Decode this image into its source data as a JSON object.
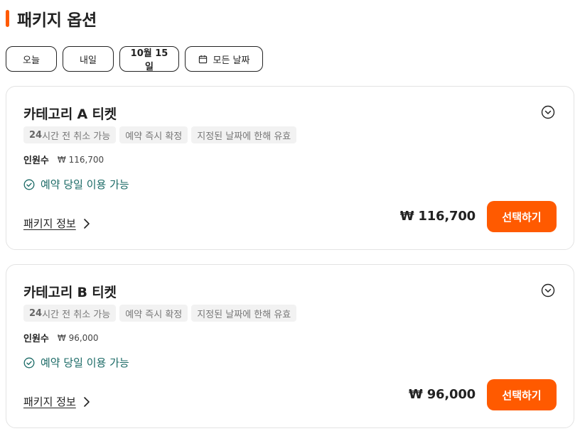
{
  "section": {
    "title": "패키지 옵션",
    "accent_color": "#ff5a00"
  },
  "date_filters": {
    "today": "오늘",
    "tomorrow": "내일",
    "date": "10월 15일",
    "all_dates": "모든 날짜",
    "calendar_icon": "calendar-icon"
  },
  "packages": [
    {
      "title": "카테고리 A 티켓",
      "tags": [
        {
          "num": "24",
          "text": "시간 전 취소 가능"
        },
        {
          "text": "예약 즉시 확정"
        },
        {
          "text": "지정된 날짜에 한해 유효"
        }
      ],
      "people_label": "인원수",
      "people_price": "₩ 116,700",
      "sameday": "예약 당일 이용 가능",
      "info_link": "패키지 정보",
      "price": "₩ 116,700",
      "select_label": "선택하기"
    },
    {
      "title": "카테고리 B 티켓",
      "tags": [
        {
          "num": "24",
          "text": "시간 전 취소 가능"
        },
        {
          "text": "예약 즉시 확정"
        },
        {
          "text": "지정된 날짜에 한해 유효"
        }
      ],
      "people_label": "인원수",
      "people_price": "₩ 96,000",
      "sameday": "예약 당일 이용 가능",
      "info_link": "패키지 정보",
      "price": "₩ 96,000",
      "select_label": "선택하기"
    }
  ],
  "colors": {
    "primary": "#ff5a00",
    "success_text": "#1b6a66",
    "tag_bg": "#f2f2f2"
  }
}
